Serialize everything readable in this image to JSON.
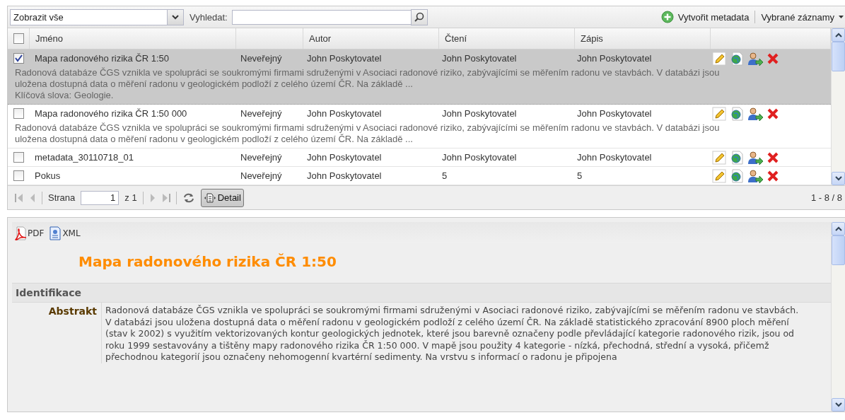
{
  "toolbar": {
    "filter": {
      "value": "Zobrazit vše"
    },
    "search_label": "Vyhledat:",
    "create_button": "Vytvořit metadata",
    "selected_menu": "Vybrané záznamy"
  },
  "table": {
    "columns": [
      "Jméno",
      "",
      "Autor",
      "Čtení",
      "Zápis"
    ],
    "header_checked": false,
    "rows": [
      {
        "selected": true,
        "checked": true,
        "name": "Mapa radonového rizika ČR 1:50",
        "access": "Neveřejný",
        "author": "John Poskytovatel",
        "read": "John Poskytovatel",
        "write": "John Poskytovatel",
        "description": "Radonová databáze ČGS vznikla ve spolupráci se soukromými firmami sdruženými v Asociaci radonové riziko, zabývajícími se měřením radonu ve stavbách. V databázi jsou uložena dostupná data o měření radonu v geologickém podloží z celého území ČR. Na základě ...",
        "keywords": "Klíčová slova: Geologie."
      },
      {
        "selected": false,
        "checked": false,
        "name": "Mapa radonového rizika ČR 1:50 000",
        "access": "Neveřejný",
        "author": "John Poskytovatel",
        "read": "John Poskytovatel",
        "write": "John Poskytovatel",
        "description": "Radonová databáze ČGS vznikla ve spolupráci se soukromými firmami sdruženými v Asociaci radonové riziko, zabývajícími se měřením radonu ve stavbách. V databázi jsou uložena dostupná data o měření radonu v geologickém podloží z celého území ČR. Na základě ..."
      },
      {
        "selected": false,
        "checked": false,
        "name": "metadata_30110718_01",
        "access": "Neveřejný",
        "author": "John Poskytovatel",
        "read": "John Poskytovatel",
        "write": "John Poskytovatel"
      },
      {
        "selected": false,
        "checked": false,
        "name": "Pokus",
        "access": "Neveřejný",
        "author": "John Poskytovatel",
        "read": "5",
        "write": "5"
      }
    ]
  },
  "paging": {
    "page_label": "Strana",
    "page": "1",
    "of": "z 1",
    "detail_button": "Detail",
    "detail_pressed": true,
    "count": "1 - 8 / 8"
  },
  "detail": {
    "exports": [
      {
        "kind": "pdf",
        "label": "PDF"
      },
      {
        "kind": "xml",
        "label": "XML"
      }
    ],
    "title": "Mapa radonového rizika ČR 1:50",
    "section": "Identifikace",
    "fields": [
      {
        "label": "Abstrakt",
        "value": "Radonová databáze ČGS vznikla ve spolupráci se soukromými firmami sdruženými v Asociaci radonové riziko, zabývajícími se měřením radonu ve stavbách. V databázi jsou uložena dostupná data o měření radonu v geologickém podloží z celého území ČR. Na základě statistického zpracování 8900 ploch měření (stav k 2002) s využitím vektorizovaných kontur geologických jednotek, které jsou barevně označeny podle převládající kategorie radonového rizik, jsou od roku 1999 sestavovány a tištěny mapy radonového rizika ČR 1:50 000. V mapě jsou použity 4 kategorie - nízká, přechodná, střední a vysoká, přičemž přechodnou kategorií jsou označeny nehomogenní kvartérní sedimenty. Na vrstvu s informací o radonu je připojena"
      }
    ]
  }
}
